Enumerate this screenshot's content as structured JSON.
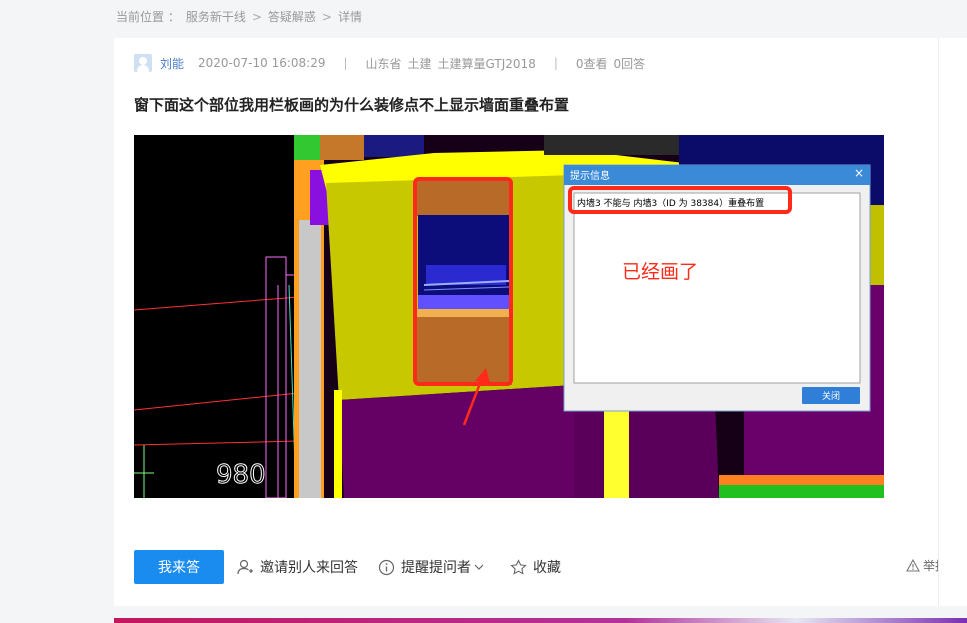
{
  "breadcrumb": {
    "prefix": "当前位置 ：",
    "items": [
      "服务新干线",
      "答疑解惑",
      "详情"
    ],
    "separator": ">"
  },
  "question": {
    "author": "刘能",
    "datetime": "2020-07-10 16:08:29",
    "region": "山东省",
    "category": "土建",
    "product": "土建算量GTJ2018",
    "views": "0查看",
    "answers": "0回答",
    "title": "窗下面这个部位我用栏板画的为什么装修点不上显示墙面重叠布置"
  },
  "screenshot": {
    "dialog_title": "提示信息",
    "dialog_close": "×",
    "dialog_message": "内墙3 不能与 内墙3（ID 为 38384）重叠布置",
    "dialog_button": "关闭",
    "annotation": "已经画了",
    "dimension_text": "980"
  },
  "actions": {
    "answer": "我来答",
    "invite": "邀请别人来回答",
    "remind": "提醒提问者",
    "favorite": "收藏",
    "report": "举报"
  },
  "colors": {
    "primary": "#1a8cf0",
    "link": "#4a7cc8",
    "annotation_red": "#ff2a1a"
  }
}
